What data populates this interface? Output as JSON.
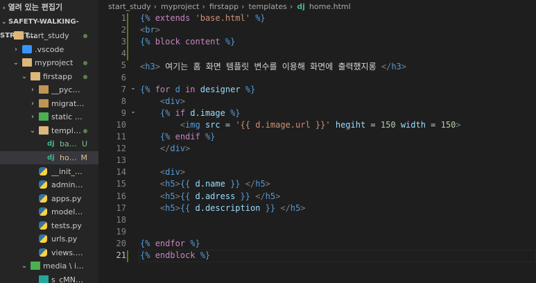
{
  "explorer": {
    "header": "열려 있는 편집기",
    "workspace": "SAFETY-WALKING-STREET...",
    "items": [
      {
        "label": "start_study",
        "type": "folder-open",
        "dot": true,
        "badge": ""
      },
      {
        "label": ".vscode",
        "type": "vscode",
        "dot": false,
        "badge": ""
      },
      {
        "label": "myproject",
        "type": "folder-open",
        "dot": true,
        "badge": ""
      },
      {
        "label": "firstapp",
        "type": "folder-open",
        "dot": true,
        "badge": ""
      },
      {
        "label": "__pycache__",
        "type": "folder",
        "dot": false,
        "badge": ""
      },
      {
        "label": "migrations",
        "type": "folder",
        "dot": false,
        "badge": ""
      },
      {
        "label": "static \\ media...",
        "type": "folder-img",
        "dot": false,
        "badge": ""
      },
      {
        "label": "templates",
        "type": "folder-open",
        "dot": true,
        "badge": ""
      },
      {
        "label": "base.ht...",
        "type": "dj",
        "dot": false,
        "badge": "U"
      },
      {
        "label": "home....",
        "type": "dj",
        "dot": false,
        "badge": "M"
      },
      {
        "label": "__init__.py",
        "type": "py",
        "dot": false,
        "badge": ""
      },
      {
        "label": "admin.py",
        "type": "py",
        "dot": false,
        "badge": ""
      },
      {
        "label": "apps.py",
        "type": "py",
        "dot": false,
        "badge": ""
      },
      {
        "label": "models.py",
        "type": "py",
        "dot": false,
        "badge": ""
      },
      {
        "label": "tests.py",
        "type": "py",
        "dot": false,
        "badge": ""
      },
      {
        "label": "urls.py",
        "type": "py",
        "dot": false,
        "badge": ""
      },
      {
        "label": "views.py",
        "type": "py",
        "dot": false,
        "badge": ""
      },
      {
        "label": "media \\ images",
        "type": "folder-img",
        "dot": false,
        "badge": ""
      },
      {
        "label": "s_cMNXqzF.P...",
        "type": "img",
        "dot": false,
        "badge": ""
      }
    ]
  },
  "breadcrumb": [
    "start_study",
    "myproject",
    "firstapp",
    "templates",
    "home.html"
  ],
  "editor": {
    "active_line": 21,
    "lines": [
      {
        "n": "1",
        "text": "{% extends 'base.html' %}"
      },
      {
        "n": "2",
        "text": "<br>"
      },
      {
        "n": "3",
        "text": "{% block content %}"
      },
      {
        "n": "4",
        "text": ""
      },
      {
        "n": "5",
        "text": "<h3> 여기는 홈 화면 템플릿 변수를 이용해 화면에 출력했지롱 </h3>"
      },
      {
        "n": "6",
        "text": ""
      },
      {
        "n": "7",
        "text": "{% for d in designer %}"
      },
      {
        "n": "8",
        "text": "    <div>"
      },
      {
        "n": "9",
        "text": "    {% if d.image %}"
      },
      {
        "n": "10",
        "text": "        <img src = '{{ d.image.url }}' hegiht = 150 width = 150>"
      },
      {
        "n": "11",
        "text": "    {% endif %}"
      },
      {
        "n": "12",
        "text": "    </div>"
      },
      {
        "n": "13",
        "text": ""
      },
      {
        "n": "14",
        "text": "    <div>"
      },
      {
        "n": "15",
        "text": "    <h5>{{ d.name }} </h5>"
      },
      {
        "n": "16",
        "text": "    <h5>{{ d.adress }} </h5>"
      },
      {
        "n": "17",
        "text": "    <h5>{{ d.description }} </h5>"
      },
      {
        "n": "18",
        "text": ""
      },
      {
        "n": "19",
        "text": ""
      },
      {
        "n": "20",
        "text": "{% endfor %}"
      },
      {
        "n": "21",
        "text": "{% endblock %}"
      }
    ]
  }
}
